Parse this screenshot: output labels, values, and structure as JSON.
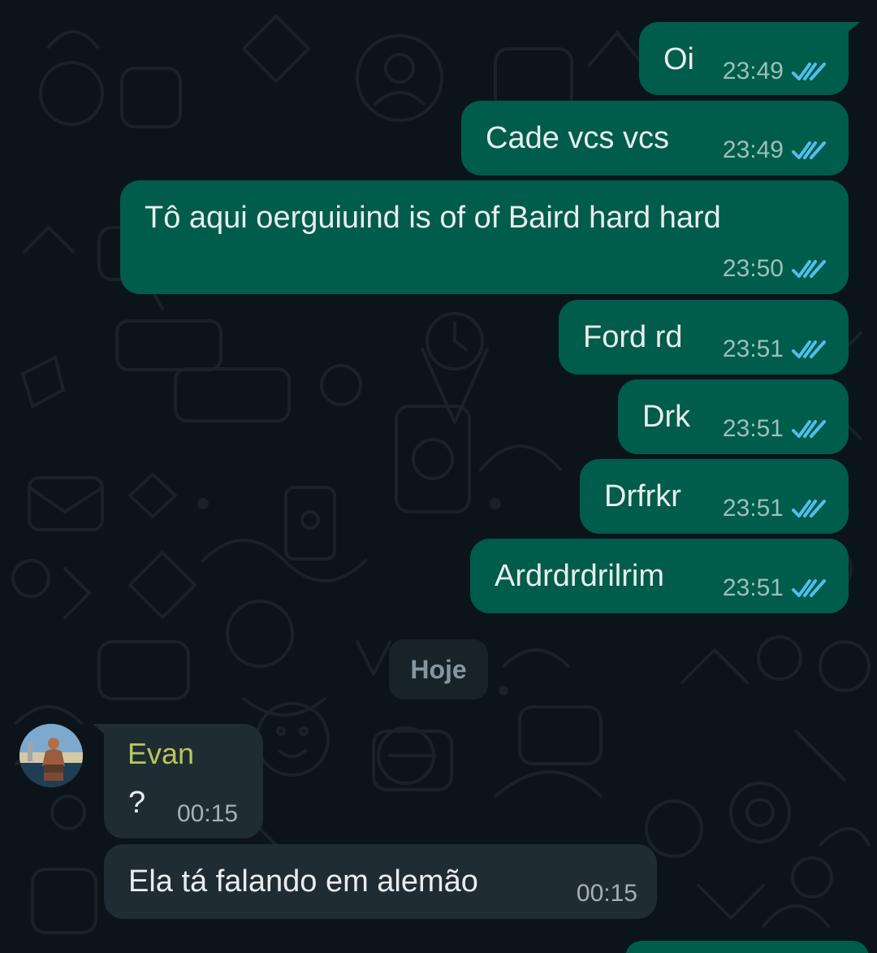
{
  "conversation": {
    "outgoing_messages": [
      {
        "text": "Oi",
        "time": "23:49",
        "status_icon": "double-check-read-icon"
      },
      {
        "text": "Cade vcs vcs",
        "time": "23:49",
        "status_icon": "double-check-read-icon"
      },
      {
        "text": "Tô aqui oerguiuind is of of Baird hard hard",
        "time": "23:50",
        "status_icon": "double-check-read-icon"
      },
      {
        "text": "Ford rd",
        "time": "23:51",
        "status_icon": "double-check-read-icon"
      },
      {
        "text": "Drk",
        "time": "23:51",
        "status_icon": "double-check-read-icon"
      },
      {
        "text": "Drfrkr",
        "time": "23:51",
        "status_icon": "double-check-read-icon"
      },
      {
        "text": "Ardrdrdrilrim",
        "time": "23:51",
        "status_icon": "double-check-read-icon"
      }
    ],
    "date_separator": "Hoje",
    "incoming_group": {
      "sender_name": "Evan",
      "avatar_icon": "profile-photo-avatar",
      "messages": [
        {
          "text": "?",
          "time": "00:15"
        },
        {
          "text": "Ela tá falando em alemão",
          "time": "00:15"
        }
      ]
    }
  },
  "colors": {
    "background": "#0b141a",
    "outgoing_bubble": "#005c4b",
    "incoming_bubble": "#202c33",
    "sender_name": "#b7c85a",
    "read_ticks": "#53bdeb",
    "date_pill": "#182229"
  }
}
